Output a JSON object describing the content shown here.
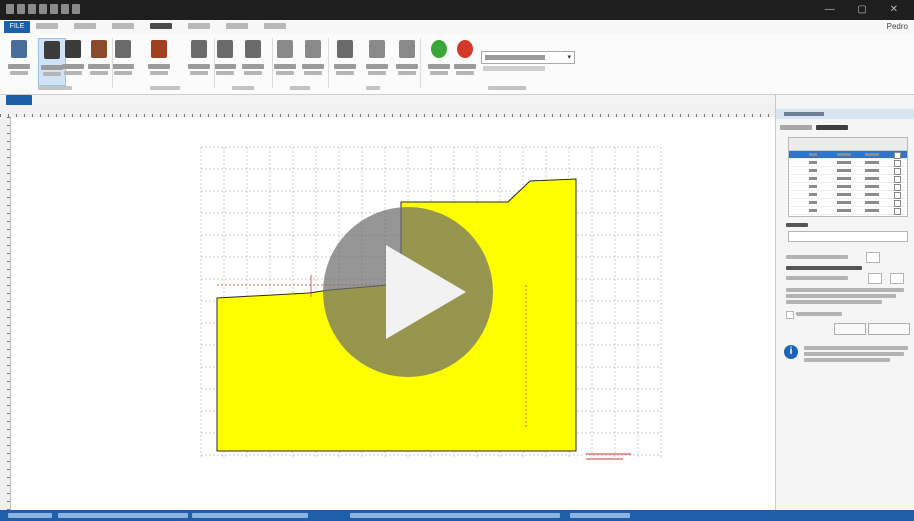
{
  "titlebar": {},
  "tabs": {
    "file_label": "FILE",
    "user_label": "Pedro"
  },
  "colors": {
    "accent_blue": "#1a5fa8",
    "section_fill": "#ffff00",
    "section_stroke": "#2a2a2a",
    "grid": "#9a9a9a",
    "status_bar": "#1f5ea8"
  },
  "ribbon": {
    "buttons": [
      {
        "icon": "document-icon",
        "color": "#4a6e9a"
      },
      {
        "icon": "layer-icon",
        "color": "#3b3b3b"
      },
      {
        "icon": "layer-icon",
        "color": "#3b3b3b"
      },
      {
        "icon": "stratigraphy-icon",
        "color": "#8b4a2a"
      },
      {
        "icon": "wall-icon",
        "color": "#6b6b6b"
      },
      {
        "icon": "excavation-icon",
        "color": "#a04020"
      },
      {
        "icon": "beam-icon",
        "color": "#6b6b6b"
      },
      {
        "icon": "support-icon",
        "color": "#6b6b6b"
      },
      {
        "icon": "anchor-icon",
        "color": "#6b6b6b"
      },
      {
        "icon": "load-icon",
        "color": "#8a8a8a"
      },
      {
        "icon": "load-icon",
        "color": "#8a8a8a"
      },
      {
        "icon": "pile-icon",
        "color": "#6b6b6b"
      },
      {
        "icon": "pile-icon",
        "color": "#8a8a8a"
      },
      {
        "icon": "pile-icon",
        "color": "#8a8a8a"
      },
      {
        "icon": "add-icon",
        "color": "#3aa63a"
      },
      {
        "icon": "delete-icon",
        "color": "#d23b2a"
      }
    ]
  },
  "status": {}
}
